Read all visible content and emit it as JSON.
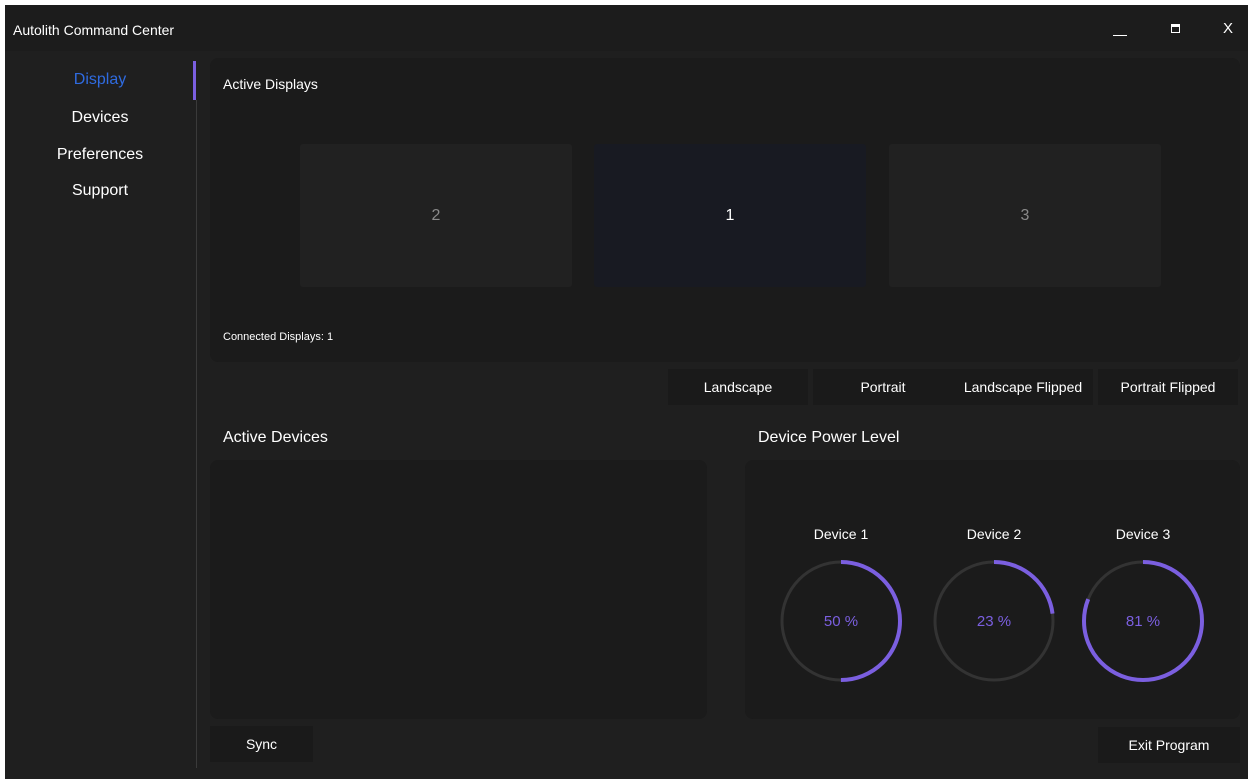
{
  "window": {
    "title": "Autolith Command Center",
    "close_label": "X"
  },
  "sidebar": {
    "items": [
      {
        "label": "Display",
        "active": true
      },
      {
        "label": "Devices",
        "active": false
      },
      {
        "label": "Preferences",
        "active": false
      },
      {
        "label": "Support",
        "active": false
      }
    ]
  },
  "displays": {
    "title": "Active Displays",
    "tiles": [
      {
        "label": "2",
        "state": "inactive"
      },
      {
        "label": "1",
        "state": "primary"
      },
      {
        "label": "3",
        "state": "inactive"
      }
    ],
    "connected_text": "Connected Displays: 1"
  },
  "orientation": {
    "buttons": [
      "Landscape",
      "Portrait",
      "Landscape Flipped",
      "Portrait Flipped"
    ]
  },
  "devices": {
    "title": "Active Devices",
    "sync_label": "Sync"
  },
  "power": {
    "title": "Device Power Level",
    "devices": [
      {
        "name": "Device 1",
        "percent_text": "50 %",
        "level": 0.5
      },
      {
        "name": "Device 2",
        "percent_text": "23 %",
        "level": 0.23
      },
      {
        "name": "Device 3",
        "percent_text": "81 %",
        "level": 0.81
      }
    ]
  },
  "footer": {
    "exit_label": "Exit Program"
  },
  "colors": {
    "accent": "#7b5fe0",
    "active_nav": "#2f6be0",
    "track": "#333333"
  },
  "icons": {
    "minimize": "minimize-icon",
    "maximize": "maximize-icon",
    "close": "close-icon"
  }
}
